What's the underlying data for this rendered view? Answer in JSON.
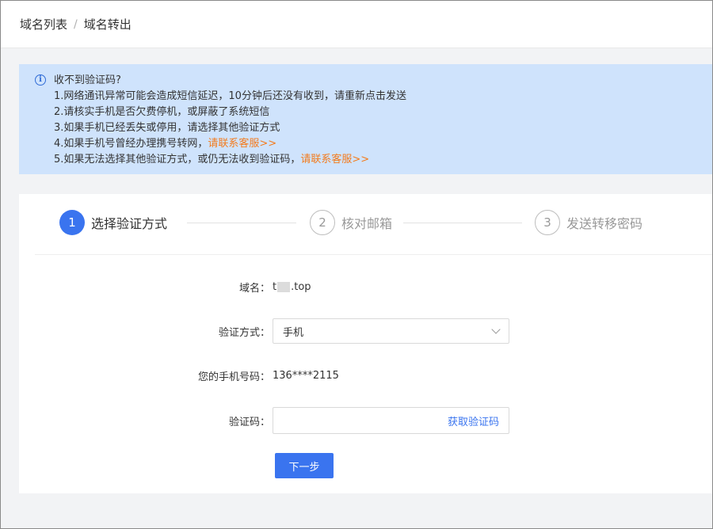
{
  "breadcrumb": {
    "items": [
      "域名列表",
      "域名转出"
    ],
    "separator": "/"
  },
  "notice": {
    "title": "收不到验证码?",
    "lines": [
      {
        "text": "1.网络通讯异常可能会造成短信延迟，10分钟后还没有收到，请重新点击发送",
        "link": ""
      },
      {
        "text": "2.请核实手机是否欠费停机，或屏蔽了系统短信",
        "link": ""
      },
      {
        "text": "3.如果手机已经丢失或停用，请选择其他验证方式",
        "link": ""
      },
      {
        "text": "4.如果手机号曾经办理携号转网，",
        "link": "请联系客服>>"
      },
      {
        "text": "5.如果无法选择其他验证方式，或仍无法收到验证码，",
        "link": "请联系客服>>"
      }
    ],
    "colors": {
      "background": "#cfe3fc",
      "link": "#f37b1d",
      "icon": "#2f6bd6"
    }
  },
  "steps": [
    {
      "number": "1",
      "label": "选择验证方式",
      "state": "active"
    },
    {
      "number": "2",
      "label": "核对邮箱",
      "state": "inactive"
    },
    {
      "number": "3",
      "label": "发送转移密码",
      "state": "inactive"
    }
  ],
  "form": {
    "domain": {
      "label": "域名：",
      "value_prefix": "t",
      "value_suffix": ".top"
    },
    "method": {
      "label": "验证方式：",
      "value": "手机"
    },
    "phone": {
      "label": "您的手机号码：",
      "value": "136****2115"
    },
    "code": {
      "label": "验证码：",
      "value": "",
      "placeholder": "",
      "action": "获取验证码"
    },
    "submit_label": "下一步"
  },
  "accent_color": "#3a74ef"
}
